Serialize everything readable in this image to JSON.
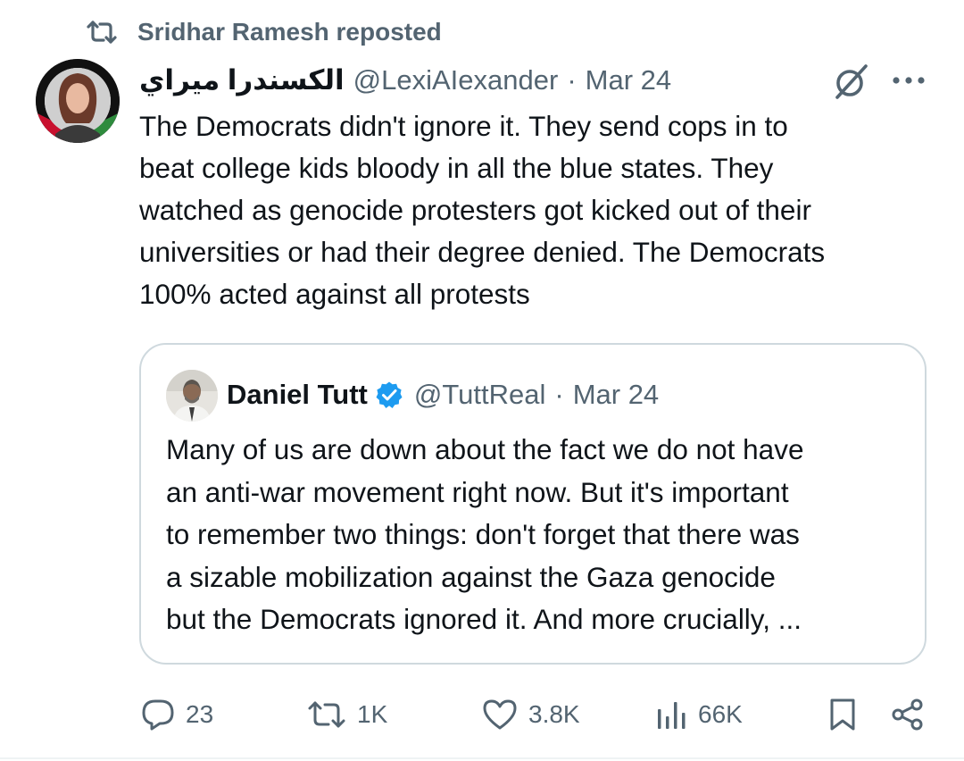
{
  "repost": {
    "icon": "repost-icon",
    "label": "Sridhar Ramesh reposted"
  },
  "post": {
    "author_name": "الكسندرا ميراي",
    "author_handle": "@LexiAIexander",
    "separator": "·",
    "date": "Mar 24",
    "text": "The Democrats didn't ignore it. They send cops in to\nbeat college kids bloody in all the blue states. They\nwatched as genocide protesters got kicked out of their\nuniversities or had their degree denied. The Democrats\n100% acted against all protests"
  },
  "quote": {
    "author_name": "Daniel Tutt",
    "verified": true,
    "author_handle": "@TuttReal",
    "separator": "·",
    "date": "Mar 24",
    "text": "Many of us are down about the fact we do not have\nan anti-war movement right now. But it's important\nto remember two things: don't forget that there was\na sizable mobilization against the Gaza genocide\nbut the Democrats ignored it. And more crucially, ..."
  },
  "actions": {
    "replies": "23",
    "reposts": "1K",
    "likes": "3.8K",
    "views": "66K"
  },
  "colors": {
    "text_primary": "#0f1419",
    "text_secondary": "#536471",
    "verified_blue": "#1d9bf0",
    "card_border": "#cfd9de"
  },
  "icons": [
    "repost-icon",
    "grok-icon",
    "more-icon",
    "verified-badge-icon",
    "reply-icon",
    "repost-action-icon",
    "like-icon",
    "views-icon",
    "bookmark-icon",
    "share-icon"
  ]
}
